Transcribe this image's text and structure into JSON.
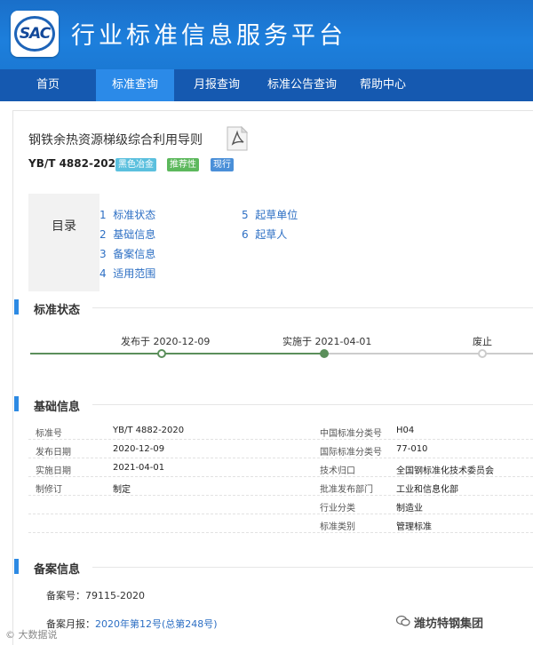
{
  "header": {
    "logo_text": "SAC",
    "site_title": "行业标准信息服务平台"
  },
  "nav": {
    "items": [
      {
        "label": "首页",
        "active": false
      },
      {
        "label": "标准查询",
        "active": true
      },
      {
        "label": "月报查询",
        "active": false
      },
      {
        "label": "标准公告查询",
        "active": false
      },
      {
        "label": "帮助中心",
        "active": false
      }
    ]
  },
  "doc": {
    "title": "钢铁余热资源梯级综合利用导则",
    "number": "YB/T 4882-2020",
    "badges": [
      {
        "label": "黑色冶金",
        "color": "#5bc0de"
      },
      {
        "label": "推荐性",
        "color": "#5cb85c"
      },
      {
        "label": "现行",
        "color": "#4a8fd8"
      }
    ]
  },
  "toc": {
    "label": "目录",
    "items": [
      {
        "num": "1",
        "label": "标准状态"
      },
      {
        "num": "2",
        "label": "基础信息"
      },
      {
        "num": "3",
        "label": "备案信息"
      },
      {
        "num": "4",
        "label": "适用范围"
      },
      {
        "num": "5",
        "label": "起草单位"
      },
      {
        "num": "6",
        "label": "起草人"
      }
    ]
  },
  "status": {
    "title": "标准状态",
    "steps": [
      {
        "label": "发布于 2020-12-09",
        "state": "done"
      },
      {
        "label": "实施于 2021-04-01",
        "state": "current"
      },
      {
        "label": "废止",
        "state": "pending"
      }
    ],
    "colors": {
      "done": "#5b8f5b",
      "pending": "#cccccc"
    }
  },
  "basic": {
    "title": "基础信息",
    "left": [
      {
        "k": "标准号",
        "v": "YB/T 4882-2020"
      },
      {
        "k": "发布日期",
        "v": "2020-12-09"
      },
      {
        "k": "实施日期",
        "v": "2021-04-01"
      },
      {
        "k": "制修订",
        "v": "制定"
      }
    ],
    "right": [
      {
        "k": "中国标准分类号",
        "v": "H04"
      },
      {
        "k": "国际标准分类号",
        "v": "77-010"
      },
      {
        "k": "技术归口",
        "v": "全国钢标准化技术委员会"
      },
      {
        "k": "批准发布部门",
        "v": "工业和信息化部"
      },
      {
        "k": "行业分类",
        "v": "制造业"
      },
      {
        "k": "标准类别",
        "v": "管理标准"
      }
    ]
  },
  "filing": {
    "title": "备案信息",
    "number_label": "备案号：",
    "number_value": "79115-2020",
    "month_label": "备案月报：",
    "month_value": "2020年第12号(总第248号)"
  },
  "watermarks": {
    "left": "© 大数据说",
    "right": "潍坊特钢集团"
  }
}
